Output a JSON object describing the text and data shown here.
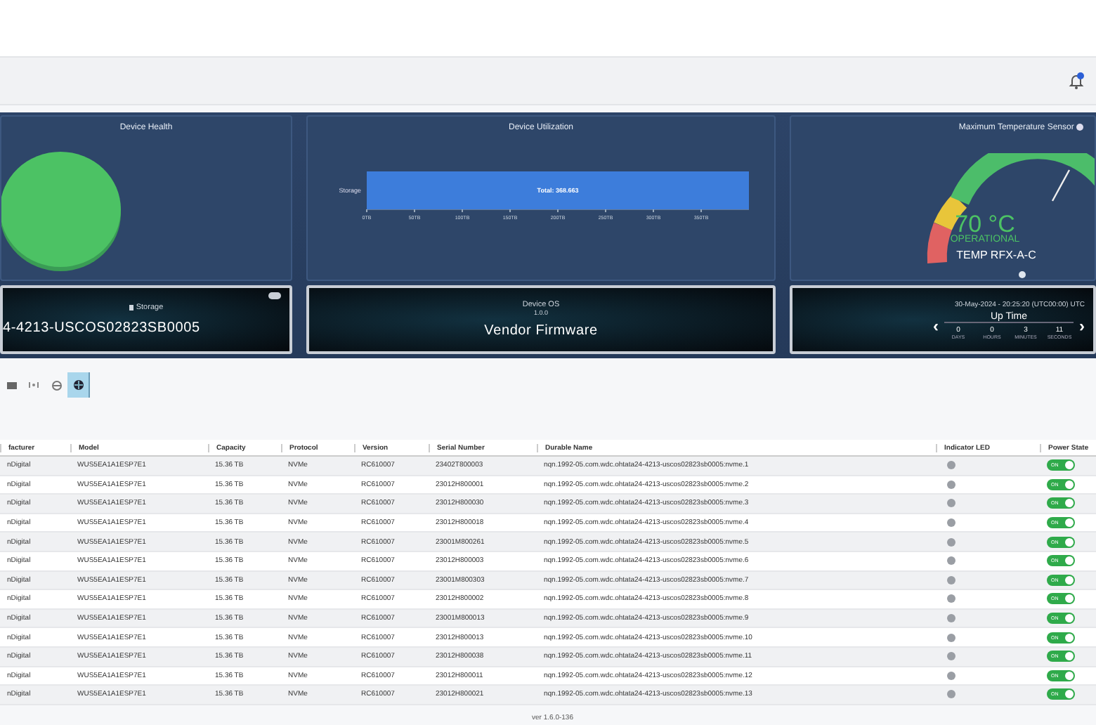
{
  "dashboard": {
    "device_health": {
      "title": "Device Health"
    },
    "device_utilization": {
      "title": "Device Utilization",
      "category": "Storage",
      "total_label": "Total: 368.663",
      "axis_labels": [
        "0TB",
        "50TB",
        "100TB",
        "150TB",
        "200TB",
        "250TB",
        "300TB",
        "350TB"
      ]
    },
    "temperature": {
      "title": "Maximum Temperature Sensor",
      "reading": "70 °C",
      "status": "OPERATIONAL",
      "sensor": "TEMP RFX-A-C"
    },
    "storage_card": {
      "label": "Storage",
      "device_name": "4-4213-USCOS02823SB0005"
    },
    "os_card": {
      "label": "Device OS",
      "version": "1.0.0",
      "firmware": "Vendor Firmware"
    },
    "uptime_card": {
      "timestamp": "30-May-2024 - 20:25:20 (UTC00:00) UTC",
      "title": "Up Time",
      "prev": "‹",
      "next": "›",
      "units": [
        {
          "value": "0",
          "label": "DAYS"
        },
        {
          "value": "0",
          "label": "HOURS"
        },
        {
          "value": "3",
          "label": "MINUTES"
        },
        {
          "value": "11",
          "label": "SECONDS"
        }
      ]
    }
  },
  "toolbar": [
    {
      "selected": false
    },
    {
      "selected": false
    },
    {
      "selected": false
    },
    {
      "selected": true
    }
  ],
  "table": {
    "columns": [
      "facturer",
      "Model",
      "Capacity",
      "Protocol",
      "Version",
      "Serial Number",
      "Durable Name",
      "Indicator LED",
      "Power State"
    ],
    "rows": [
      {
        "cells": [
          "nDigital",
          "WUS5EA1A1ESP7E1",
          "15.36 TB",
          "NVMe",
          "RC610007",
          "23402T800003",
          "nqn.1992-05.com.wdc.ohtata24-4213-uscos02823sb0005:nvme.1"
        ],
        "led_on": false,
        "power": {
          "label": "ON",
          "on": true
        }
      },
      {
        "cells": [
          "nDigital",
          "WUS5EA1A1ESP7E1",
          "15.36 TB",
          "NVMe",
          "RC610007",
          "23012H800001",
          "nqn.1992-05.com.wdc.ohtata24-4213-uscos02823sb0005:nvme.2"
        ],
        "led_on": false,
        "power": {
          "label": "ON",
          "on": true
        }
      },
      {
        "cells": [
          "nDigital",
          "WUS5EA1A1ESP7E1",
          "15.36 TB",
          "NVMe",
          "RC610007",
          "23012H800030",
          "nqn.1992-05.com.wdc.ohtata24-4213-uscos02823sb0005:nvme.3"
        ],
        "led_on": false,
        "power": {
          "label": "ON",
          "on": true
        }
      },
      {
        "cells": [
          "nDigital",
          "WUS5EA1A1ESP7E1",
          "15.36 TB",
          "NVMe",
          "RC610007",
          "23012H800018",
          "nqn.1992-05.com.wdc.ohtata24-4213-uscos02823sb0005:nvme.4"
        ],
        "led_on": false,
        "power": {
          "label": "ON",
          "on": true
        }
      },
      {
        "cells": [
          "nDigital",
          "WUS5EA1A1ESP7E1",
          "15.36 TB",
          "NVMe",
          "RC610007",
          "23001M800261",
          "nqn.1992-05.com.wdc.ohtata24-4213-uscos02823sb0005:nvme.5"
        ],
        "led_on": false,
        "power": {
          "label": "ON",
          "on": true
        }
      },
      {
        "cells": [
          "nDigital",
          "WUS5EA1A1ESP7E1",
          "15.36 TB",
          "NVMe",
          "RC610007",
          "23012H800003",
          "nqn.1992-05.com.wdc.ohtata24-4213-uscos02823sb0005:nvme.6"
        ],
        "led_on": false,
        "power": {
          "label": "ON",
          "on": true
        }
      },
      {
        "cells": [
          "nDigital",
          "WUS5EA1A1ESP7E1",
          "15.36 TB",
          "NVMe",
          "RC610007",
          "23001M800303",
          "nqn.1992-05.com.wdc.ohtata24-4213-uscos02823sb0005:nvme.7"
        ],
        "led_on": false,
        "power": {
          "label": "ON",
          "on": true
        }
      },
      {
        "cells": [
          "nDigital",
          "WUS5EA1A1ESP7E1",
          "15.36 TB",
          "NVMe",
          "RC610007",
          "23012H800002",
          "nqn.1992-05.com.wdc.ohtata24-4213-uscos02823sb0005:nvme.8"
        ],
        "led_on": false,
        "power": {
          "label": "ON",
          "on": true
        }
      },
      {
        "cells": [
          "nDigital",
          "WUS5EA1A1ESP7E1",
          "15.36 TB",
          "NVMe",
          "RC610007",
          "23001M800013",
          "nqn.1992-05.com.wdc.ohtata24-4213-uscos02823sb0005:nvme.9"
        ],
        "led_on": false,
        "power": {
          "label": "ON",
          "on": true
        }
      },
      {
        "cells": [
          "nDigital",
          "WUS5EA1A1ESP7E1",
          "15.36 TB",
          "NVMe",
          "RC610007",
          "23012H800013",
          "nqn.1992-05.com.wdc.ohtata24-4213-uscos02823sb0005:nvme.10"
        ],
        "led_on": false,
        "power": {
          "label": "ON",
          "on": true
        }
      },
      {
        "cells": [
          "nDigital",
          "WUS5EA1A1ESP7E1",
          "15.36 TB",
          "NVMe",
          "RC610007",
          "23012H800038",
          "nqn.1992-05.com.wdc.ohtata24-4213-uscos02823sb0005:nvme.11"
        ],
        "led_on": false,
        "power": {
          "label": "ON",
          "on": true
        }
      },
      {
        "cells": [
          "nDigital",
          "WUS5EA1A1ESP7E1",
          "15.36 TB",
          "NVMe",
          "RC610007",
          "23012H800011",
          "nqn.1992-05.com.wdc.ohtata24-4213-uscos02823sb0005:nvme.12"
        ],
        "led_on": false,
        "power": {
          "label": "ON",
          "on": true
        }
      },
      {
        "cells": [
          "nDigital",
          "WUS5EA1A1ESP7E1",
          "15.36 TB",
          "NVMe",
          "RC610007",
          "23012H800021",
          "nqn.1992-05.com.wdc.ohtata24-4213-uscos02823sb0005:nvme.13"
        ],
        "led_on": false,
        "power": {
          "label": "ON",
          "on": true
        }
      }
    ]
  },
  "footer": {
    "version": "ver 1.6.0-136"
  }
}
